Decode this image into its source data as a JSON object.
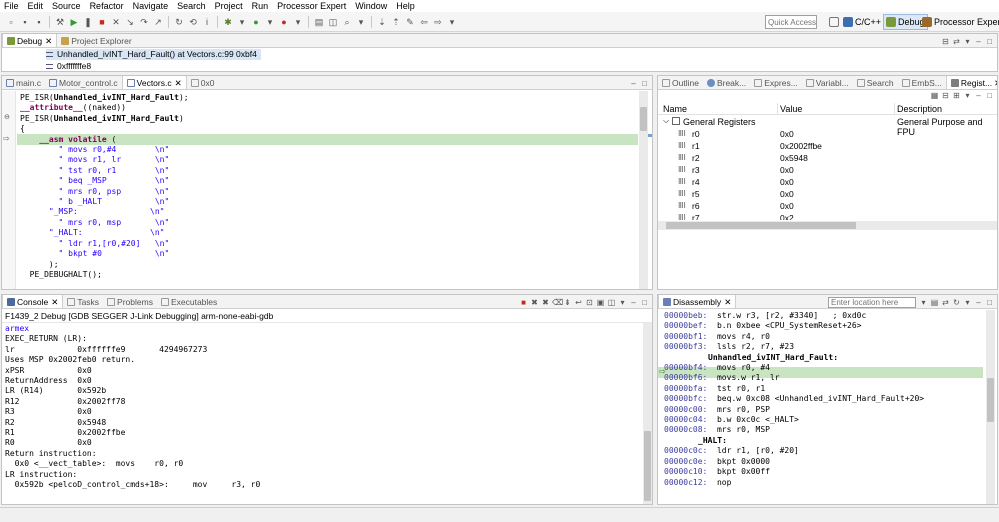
{
  "menu": [
    "File",
    "Edit",
    "Source",
    "Refactor",
    "Navigate",
    "Search",
    "Project",
    "Run",
    "Processor Expert",
    "Window",
    "Help"
  ],
  "toolbar": {
    "quick_access_placeholder": "Quick Access",
    "perspectives": [
      {
        "label": "C/C++",
        "active": false
      },
      {
        "label": "Debug",
        "active": true
      },
      {
        "label": "Processor Expert",
        "active": false
      }
    ]
  },
  "debug_view": {
    "tabs": [
      {
        "label": "Debug",
        "active": true
      },
      {
        "label": "Project Explorer",
        "active": false
      }
    ],
    "frames": [
      {
        "label": "Unhandled_ivINT_Hard_Fault() at Vectors.c:99 0xbf4",
        "selected": true
      },
      {
        "label": "0xfffffffe8",
        "selected": false
      }
    ]
  },
  "editor": {
    "tabs": [
      {
        "label": "main.c",
        "active": false
      },
      {
        "label": "Motor_control.c",
        "active": false
      },
      {
        "label": "Vectors.c",
        "active": true
      },
      {
        "label": "0x0",
        "active": false
      }
    ],
    "lines": [
      {
        "segments": [
          {
            "t": "PE_ISR(",
            "c": ""
          },
          {
            "t": "Unhandled_ivINT_Hard_Fault",
            "c": "fn"
          },
          {
            "t": ");",
            "c": ""
          }
        ]
      },
      {
        "segments": [
          {
            "t": "__attribute__",
            "c": "kw"
          },
          {
            "t": "((naked))",
            "c": ""
          }
        ]
      },
      {
        "segments": [
          {
            "t": "PE_ISR(",
            "c": ""
          },
          {
            "t": "Unhandled_ivINT_Hard_Fault",
            "c": "fn"
          },
          {
            "t": ")",
            "c": ""
          }
        ]
      },
      {
        "segments": [
          {
            "t": "{",
            "c": ""
          }
        ]
      },
      {
        "segments": [
          {
            "t": "    ",
            "c": ""
          },
          {
            "t": "__asm volatile",
            "c": "kw"
          },
          {
            "t": " (",
            "c": ""
          }
        ]
      },
      {
        "segments": [
          {
            "t": "        ",
            "c": ""
          },
          {
            "t": "\" movs r0,#4        \\n\"",
            "c": "str"
          }
        ]
      },
      {
        "segments": [
          {
            "t": "        ",
            "c": ""
          },
          {
            "t": "\" movs r1, lr       \\n\"",
            "c": "str"
          }
        ]
      },
      {
        "segments": [
          {
            "t": "        ",
            "c": ""
          },
          {
            "t": "\" tst r0, r1        \\n\"",
            "c": "str"
          }
        ]
      },
      {
        "segments": [
          {
            "t": "        ",
            "c": ""
          },
          {
            "t": "\" beq _MSP          \\n\"",
            "c": "str"
          }
        ]
      },
      {
        "segments": [
          {
            "t": "        ",
            "c": ""
          },
          {
            "t": "\" mrs r0, psp       \\n\"",
            "c": "str"
          }
        ]
      },
      {
        "segments": [
          {
            "t": "        ",
            "c": ""
          },
          {
            "t": "\" b _HALT           \\n\"",
            "c": "str"
          }
        ]
      },
      {
        "segments": [
          {
            "t": "      ",
            "c": ""
          },
          {
            "t": "\"_MSP:               \\n\"",
            "c": "str"
          }
        ]
      },
      {
        "segments": [
          {
            "t": "        ",
            "c": ""
          },
          {
            "t": "\" mrs r0, msp       \\n\"",
            "c": "str"
          }
        ]
      },
      {
        "segments": [
          {
            "t": "      ",
            "c": ""
          },
          {
            "t": "\"_HALT:              \\n\"",
            "c": "str"
          }
        ]
      },
      {
        "segments": [
          {
            "t": "        ",
            "c": ""
          },
          {
            "t": "\" ldr r1,[r0,#20]   \\n\"",
            "c": "str"
          }
        ]
      },
      {
        "segments": [
          {
            "t": "        ",
            "c": ""
          },
          {
            "t": "\" bkpt #0           \\n\"",
            "c": "str"
          }
        ]
      },
      {
        "segments": [
          {
            "t": "      );",
            "c": ""
          }
        ]
      },
      {
        "segments": [
          {
            "t": "  PE_DEBUGHALT();",
            "c": ""
          }
        ]
      }
    ]
  },
  "registers_view": {
    "tabs": [
      {
        "label": "Outline",
        "active": false
      },
      {
        "label": "Break...",
        "active": false
      },
      {
        "label": "Expres...",
        "active": false
      },
      {
        "label": "Variabl...",
        "active": false
      },
      {
        "label": "Search",
        "active": false
      },
      {
        "label": "EmbS...",
        "active": false
      },
      {
        "label": "Regist...",
        "active": true
      }
    ],
    "columns": [
      "Name",
      "Value",
      "Description"
    ],
    "group": {
      "name": "General Registers",
      "description": "General Purpose and FPU"
    },
    "rows": [
      {
        "name": "r0",
        "value": "0x0"
      },
      {
        "name": "r1",
        "value": "0x2002ffbe"
      },
      {
        "name": "r2",
        "value": "0x5948"
      },
      {
        "name": "r3",
        "value": "0x0"
      },
      {
        "name": "r4",
        "value": "0x0"
      },
      {
        "name": "r5",
        "value": "0x0"
      },
      {
        "name": "r6",
        "value": "0x0"
      },
      {
        "name": "r7",
        "value": "0x2"
      }
    ]
  },
  "console_view": {
    "tabs": [
      {
        "label": "Console",
        "active": true
      },
      {
        "label": "Tasks",
        "active": false
      },
      {
        "label": "Problems",
        "active": false
      },
      {
        "label": "Executables",
        "active": false
      }
    ],
    "session": "F1439_2 Debug [GDB SEGGER J-Link Debugging] arm-none-eabi-gdb",
    "lines": [
      {
        "text": "armex",
        "blue": true
      },
      {
        "text": "EXEC_RETURN (LR):",
        "blue": false
      },
      {
        "text": "lr             0xffffffe9       4294967273",
        "blue": false
      },
      {
        "text": "Uses MSP 0x2002feb0 return.",
        "blue": false
      },
      {
        "text": "xPSR           0x0",
        "blue": false
      },
      {
        "text": "ReturnAddress  0x0",
        "blue": false
      },
      {
        "text": "LR (R14)       0x592b",
        "blue": false
      },
      {
        "text": "R12            0x2002ff78",
        "blue": false
      },
      {
        "text": "R3             0x0",
        "blue": false
      },
      {
        "text": "R2             0x5948",
        "blue": false
      },
      {
        "text": "R1             0x2002ffbe",
        "blue": false
      },
      {
        "text": "R0             0x0",
        "blue": false
      },
      {
        "text": "Return instruction:",
        "blue": false
      },
      {
        "text": "  0x0 <__vect_table>:  movs    r0, r0",
        "blue": false
      },
      {
        "text": "LR instruction:",
        "blue": false
      },
      {
        "text": "  0x592b <pelcoD_control_cmds+18>:     mov     r3, r0",
        "blue": false
      }
    ]
  },
  "disassembly_view": {
    "tab": "Disassembly",
    "location_placeholder": "Enter location here",
    "lines": [
      {
        "addr": "00000beb:",
        "text": "  str.w r3, [r2, #3340]   ; 0xd0c",
        "label": false,
        "current": false
      },
      {
        "addr": "00000bef:",
        "text": "  b.n 0xbee <CPU_SystemReset+26>",
        "label": false,
        "current": false
      },
      {
        "addr": "00000bf1:",
        "text": "  movs r4, r0",
        "label": false,
        "current": false
      },
      {
        "addr": "00000bf3:",
        "text": "  lsls r2, r7, #23",
        "label": false,
        "current": false
      },
      {
        "addr": "",
        "text": "Unhandled_ivINT_Hard_Fault:",
        "label": true,
        "current": false
      },
      {
        "addr": "00000bf4:",
        "text": "  movs r0, #4",
        "label": false,
        "current": true
      },
      {
        "addr": "00000bf6:",
        "text": "  movs.w r1, lr",
        "label": false,
        "current": false
      },
      {
        "addr": "00000bfa:",
        "text": "  tst r0, r1",
        "label": false,
        "current": false
      },
      {
        "addr": "00000bfc:",
        "text": "  beq.w 0xc08 <Unhandled_ivINT_Hard_Fault+20>",
        "label": false,
        "current": false
      },
      {
        "addr": "00000c00:",
        "text": "  mrs r0, PSP",
        "label": false,
        "current": false
      },
      {
        "addr": "00000c04:",
        "text": "  b.w 0xc0c <_HALT>",
        "label": false,
        "current": false
      },
      {
        "addr": "00000c08:",
        "text": "  mrs r0, MSP",
        "label": false,
        "current": false
      },
      {
        "addr": "",
        "text": "_HALT:",
        "label": true,
        "current": false
      },
      {
        "addr": "00000c0c:",
        "text": "  ldr r1, [r0, #20]",
        "label": false,
        "current": false
      },
      {
        "addr": "00000c0e:",
        "text": "  bkpt 0x0000",
        "label": false,
        "current": false
      },
      {
        "addr": "00000c10:",
        "text": "  bkpt 0x00ff",
        "label": false,
        "current": false
      },
      {
        "addr": "00000c12:",
        "text": "  nop",
        "label": false,
        "current": false
      }
    ]
  }
}
